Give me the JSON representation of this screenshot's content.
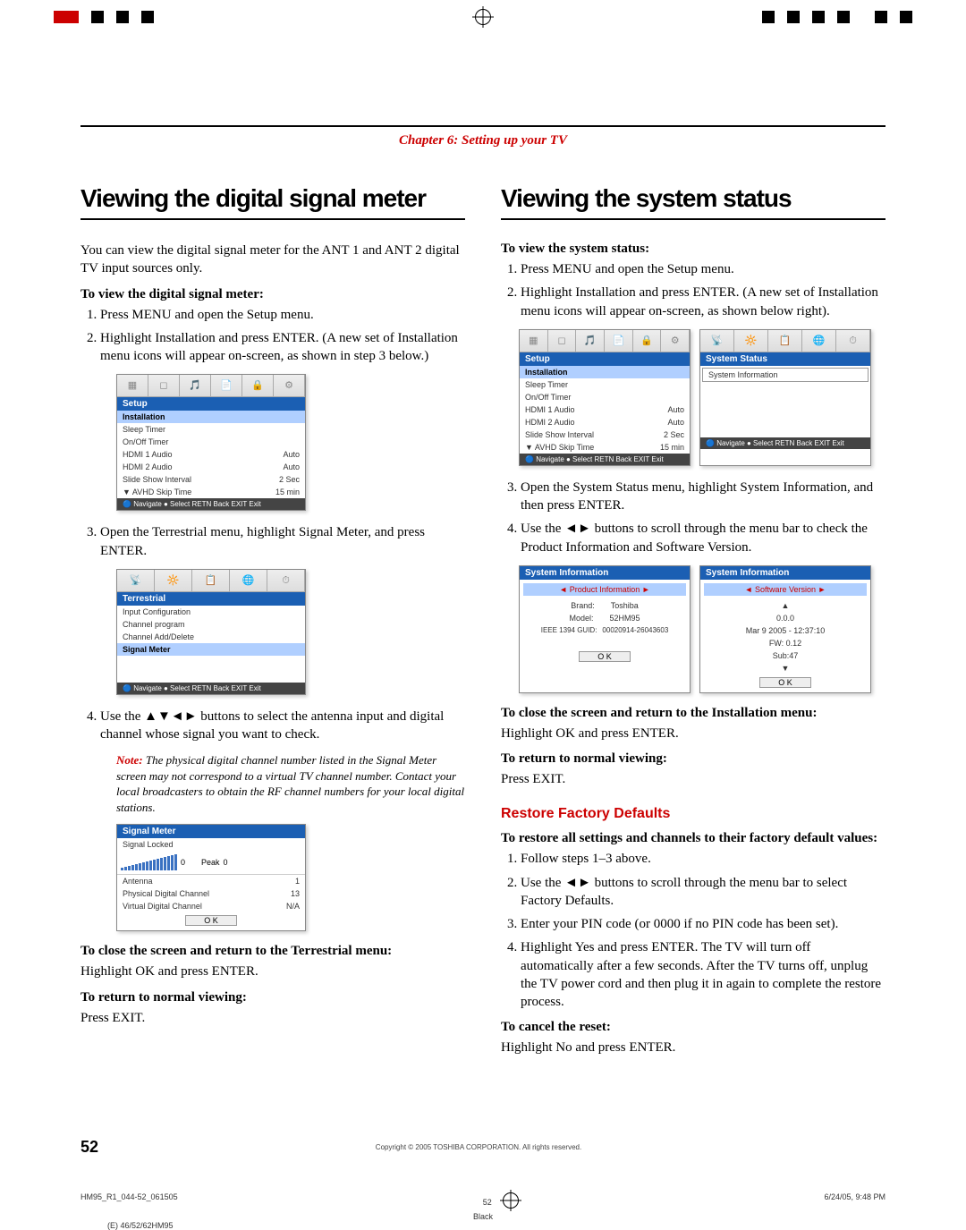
{
  "chapter": "Chapter 6: Setting up your TV",
  "col1": {
    "h1": "Viewing the digital signal meter",
    "intro": "You can view the digital signal meter for the ANT 1 and ANT 2 digital TV input sources only.",
    "sub1": "To view the digital signal meter:",
    "step1": "Press MENU and open the Setup menu.",
    "step2": "Highlight Installation and press ENTER. (A new set of Installation menu icons will appear on-screen, as shown in step 3 below.)",
    "osd1": {
      "title": "Setup",
      "hi": "Installation",
      "r1": "Sleep Timer",
      "r2": "On/Off Timer",
      "r3a": "HDMI 1 Audio",
      "r3b": "Auto",
      "r4a": "HDMI 2 Audio",
      "r4b": "Auto",
      "r5a": "Slide Show Interval",
      "r5b": "2 Sec",
      "r6a": "AVHD Skip Time",
      "r6b": "15 min"
    },
    "step3": "Open the Terrestrial menu, highlight Signal Meter, and press ENTER.",
    "osd2": {
      "title": "Terrestrial",
      "r1": "Input Configuration",
      "r2": "Channel program",
      "r3": "Channel Add/Delete",
      "hi": "Signal Meter"
    },
    "step4": "Use the ▲▼◄► buttons to select the antenna input and digital channel whose signal you want to check.",
    "note_prefix": "Note:",
    "note": "The physical digital channel number listed in the Signal Meter screen may not correspond to a virtual TV channel number. Contact your local broadcasters to obtain the RF channel numbers for your local digital stations.",
    "osd3": {
      "title": "Signal Meter",
      "locked": "Signal Locked",
      "val0": "0",
      "peak": "Peak",
      "pval": "0",
      "r1a": "Antenna",
      "r1b": "1",
      "r2a": "Physical Digital Channel",
      "r2b": "13",
      "r3a": "Virtual Digital Channel",
      "r3b": "N/A",
      "ok": "O K"
    },
    "sub2": "To close the screen and return to the Terrestrial menu:",
    "close_text": "Highlight OK and press ENTER.",
    "sub3": "To return to normal viewing:",
    "exit_text": "Press EXIT."
  },
  "col2": {
    "h1": "Viewing the system status",
    "sub1": "To view the system status:",
    "step1": "Press MENU and open the Setup menu.",
    "step2": "Highlight Installation and press ENTER. (A new set of Installation menu icons will appear on-screen, as shown below right).",
    "osdA": {
      "title": "Setup",
      "hi": "Installation",
      "r1": "Sleep Timer",
      "r2": "On/Off Timer",
      "r3a": "HDMI 1 Audio",
      "r3b": "Auto",
      "r4a": "HDMI 2 Audio",
      "r4b": "Auto",
      "r5a": "Slide Show Interval",
      "r5b": "2 Sec",
      "r6a": "AVHD Skip Time",
      "r6b": "15 min"
    },
    "osdB": {
      "title": "System Status",
      "r1": "System Information"
    },
    "step3": "Open the System Status menu, highlight System Information, and then press ENTER.",
    "step4": "Use the ◄► buttons to scroll through the menu bar to check the Product Information and Software Version.",
    "osdC": {
      "title": "System Information",
      "sub": "Product Information",
      "r1a": "Brand:",
      "r1b": "Toshiba",
      "r2a": "Model:",
      "r2b": "52HM95",
      "r3a": "IEEE 1394 GUID:",
      "r3b": "00020914-26043603",
      "ok": "O K"
    },
    "osdD": {
      "title": "System Information",
      "sub": "Software Version",
      "r1": "0.0.0",
      "r2": "Mar 9 2005 - 12:37:10",
      "r3": "FW: 0.12",
      "r4": "Sub:47",
      "ok": "O K"
    },
    "sub2": "To close the screen and return to the Installation menu:",
    "close_text": "Highlight OK and press ENTER.",
    "sub3": "To return to normal viewing:",
    "exit_text": "Press EXIT.",
    "restore_head": "Restore Factory Defaults",
    "restore_intro": "To restore all settings and channels to their factory default values:",
    "rstep1": "Follow steps 1–3 above.",
    "rstep2": "Use the ◄► buttons to scroll through the menu bar to select Factory Defaults.",
    "rstep3": "Enter your PIN code (or 0000 if no PIN code has been set).",
    "rstep4": "Highlight Yes and press ENTER. The TV will turn off automatically after a few seconds. After the TV turns off, unplug the TV power cord and then plug it in again to complete the restore process.",
    "sub4": "To cancel the reset:",
    "cancel_text": "Highlight No and press ENTER."
  },
  "nav_text": "Navigate  ● Select  RETN Back  EXIT Exit",
  "footer": {
    "page": "52",
    "copyright": "Copyright © 2005 TOSHIBA CORPORATION. All rights reserved."
  },
  "crop": {
    "left": "HM95_R1_044-52_061505",
    "mid": "52",
    "right": "6/24/05, 9:48 PM",
    "black": "Black",
    "model": "(E) 46/52/62HM95"
  }
}
